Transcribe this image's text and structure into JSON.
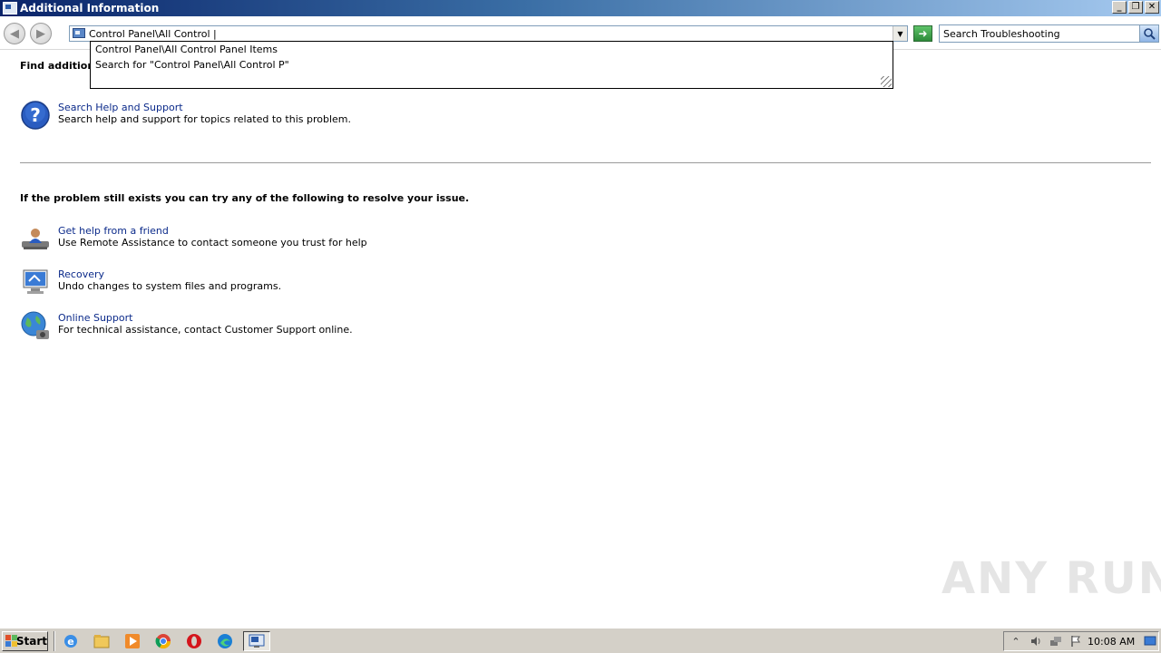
{
  "window": {
    "title": "Additional Information",
    "minimize_glyph": "_",
    "restore_glyph": "❐",
    "close_glyph": "✕"
  },
  "nav": {
    "back_glyph": "◀",
    "forward_glyph": "▶",
    "address_value": "Control Panel\\All Control |",
    "dropdown_glyph": "▼",
    "go_glyph": "➜",
    "search_placeholder": "Search Troubleshooting"
  },
  "autocomplete": {
    "items": [
      "Control Panel\\All Control Panel Items",
      "Search for \"Control Panel\\All Control P\""
    ]
  },
  "content": {
    "find_heading": "Find additional",
    "help_task": {
      "title": "Search Help and Support",
      "description": "Search help and support for topics related to this problem."
    },
    "resolve_heading": "If the problem still exists you can try any of the following to resolve your issue.",
    "tasks": [
      {
        "title": "Get help from a friend",
        "description": "Use Remote Assistance to contact someone you trust for help"
      },
      {
        "title": "Recovery",
        "description": "Undo changes to system files and programs."
      },
      {
        "title": "Online Support",
        "description": "For technical assistance, contact Customer Support online."
      }
    ]
  },
  "watermark": "ANY RUN",
  "taskbar": {
    "start_label": "Start",
    "clock": "10:08 AM",
    "pinned_icons": [
      "ie-icon",
      "explorer-icon",
      "media-player-icon",
      "chrome-icon",
      "opera-icon",
      "edge-icon"
    ],
    "active_window_icon": "troubleshooting-window-icon"
  },
  "colors": {
    "link": "#0b2a8a",
    "titlebar_start": "#0a246a",
    "titlebar_end": "#a6caf0",
    "taskbar": "#d4d0c8"
  }
}
